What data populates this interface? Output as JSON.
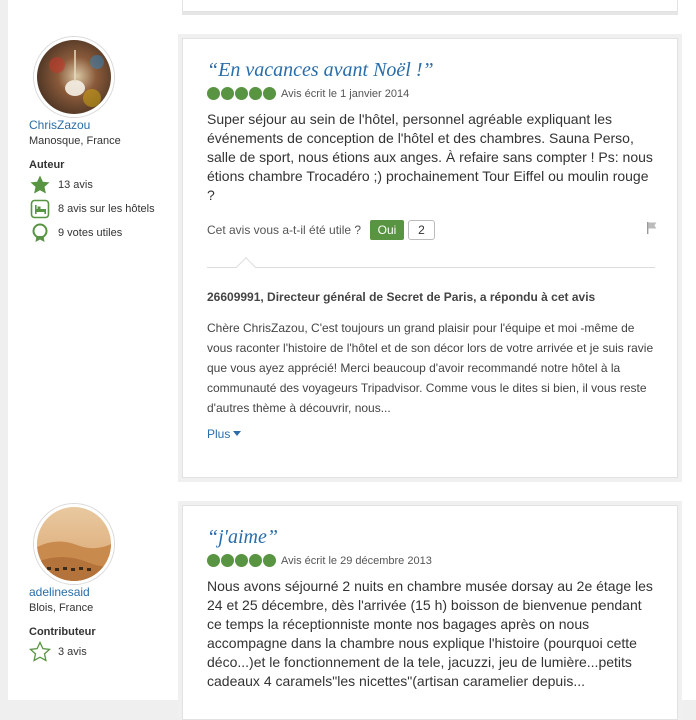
{
  "reviews": [
    {
      "user": {
        "name": "ChrisZazou",
        "location": "Manosque, France",
        "level": "Auteur",
        "stats": [
          {
            "icon": "star-icon",
            "text": "13 avis"
          },
          {
            "icon": "hotel-bed-icon",
            "text": "8 avis sur les hôtels"
          },
          {
            "icon": "helpful-badge-icon",
            "text": "9 votes utiles"
          }
        ]
      },
      "title": "“En vacances avant Noël !”",
      "rating": 5,
      "date": "Avis écrit le 1 janvier 2014",
      "body": "Super séjour au sein de l'hôtel, personnel agréable expliquant les événements de conception de l'hôtel et des chambres. Sauna Perso, salle de sport, nous étions aux anges. À refaire sans compter ! Ps: nous étions chambre Trocadéro ;) prochainement Tour Eiffel ou moulin rouge ?",
      "helpful_question": "Cet avis vous a-t-il été utile ?",
      "yes_label": "Oui",
      "helpful_count": "2",
      "response": {
        "title": "26609991, Directeur général de Secret de Paris, a répondu à cet avis",
        "text": "Chère ChrisZazou, C'est toujours un grand plaisir pour l'équipe et moi -même de vous raconter l'histoire de l'hôtel et de son décor lors de votre arrivée et je suis ravie que vous ayez apprécié! Merci beaucoup d'avoir recommandé notre hôtel à la communauté des voyageurs Tripadvisor. Comme vous le dites si bien, il vous reste d'autres thème à découvrir, nous...",
        "more_label": "Plus"
      }
    },
    {
      "user": {
        "name": "adelinesaid",
        "location": "Blois, France",
        "level": "Contributeur",
        "stats": [
          {
            "icon": "star-outline-icon",
            "text": "3 avis"
          }
        ]
      },
      "title": "“j'aime”",
      "rating": 5,
      "date": "Avis écrit le 29 décembre 2013",
      "body": "Nous avons séjourné 2 nuits en chambre musée dorsay au 2e étage les 24 et 25 décembre, dès l'arrivée (15 h) boisson de bienvenue pendant ce temps la réceptionniste monte nos bagages après on nous accompagne dans la chambre nous explique l'histoire (pourquoi cette déco...)et le fonctionnement de la tele, jacuzzi, jeu de lumière...petits cadeaux 4 caramels\"les nicettes\"(artisan caramelier depuis..."
    }
  ],
  "colors": {
    "link": "#2a6da8",
    "rating_green": "#589442",
    "yes_button": "#589442"
  }
}
